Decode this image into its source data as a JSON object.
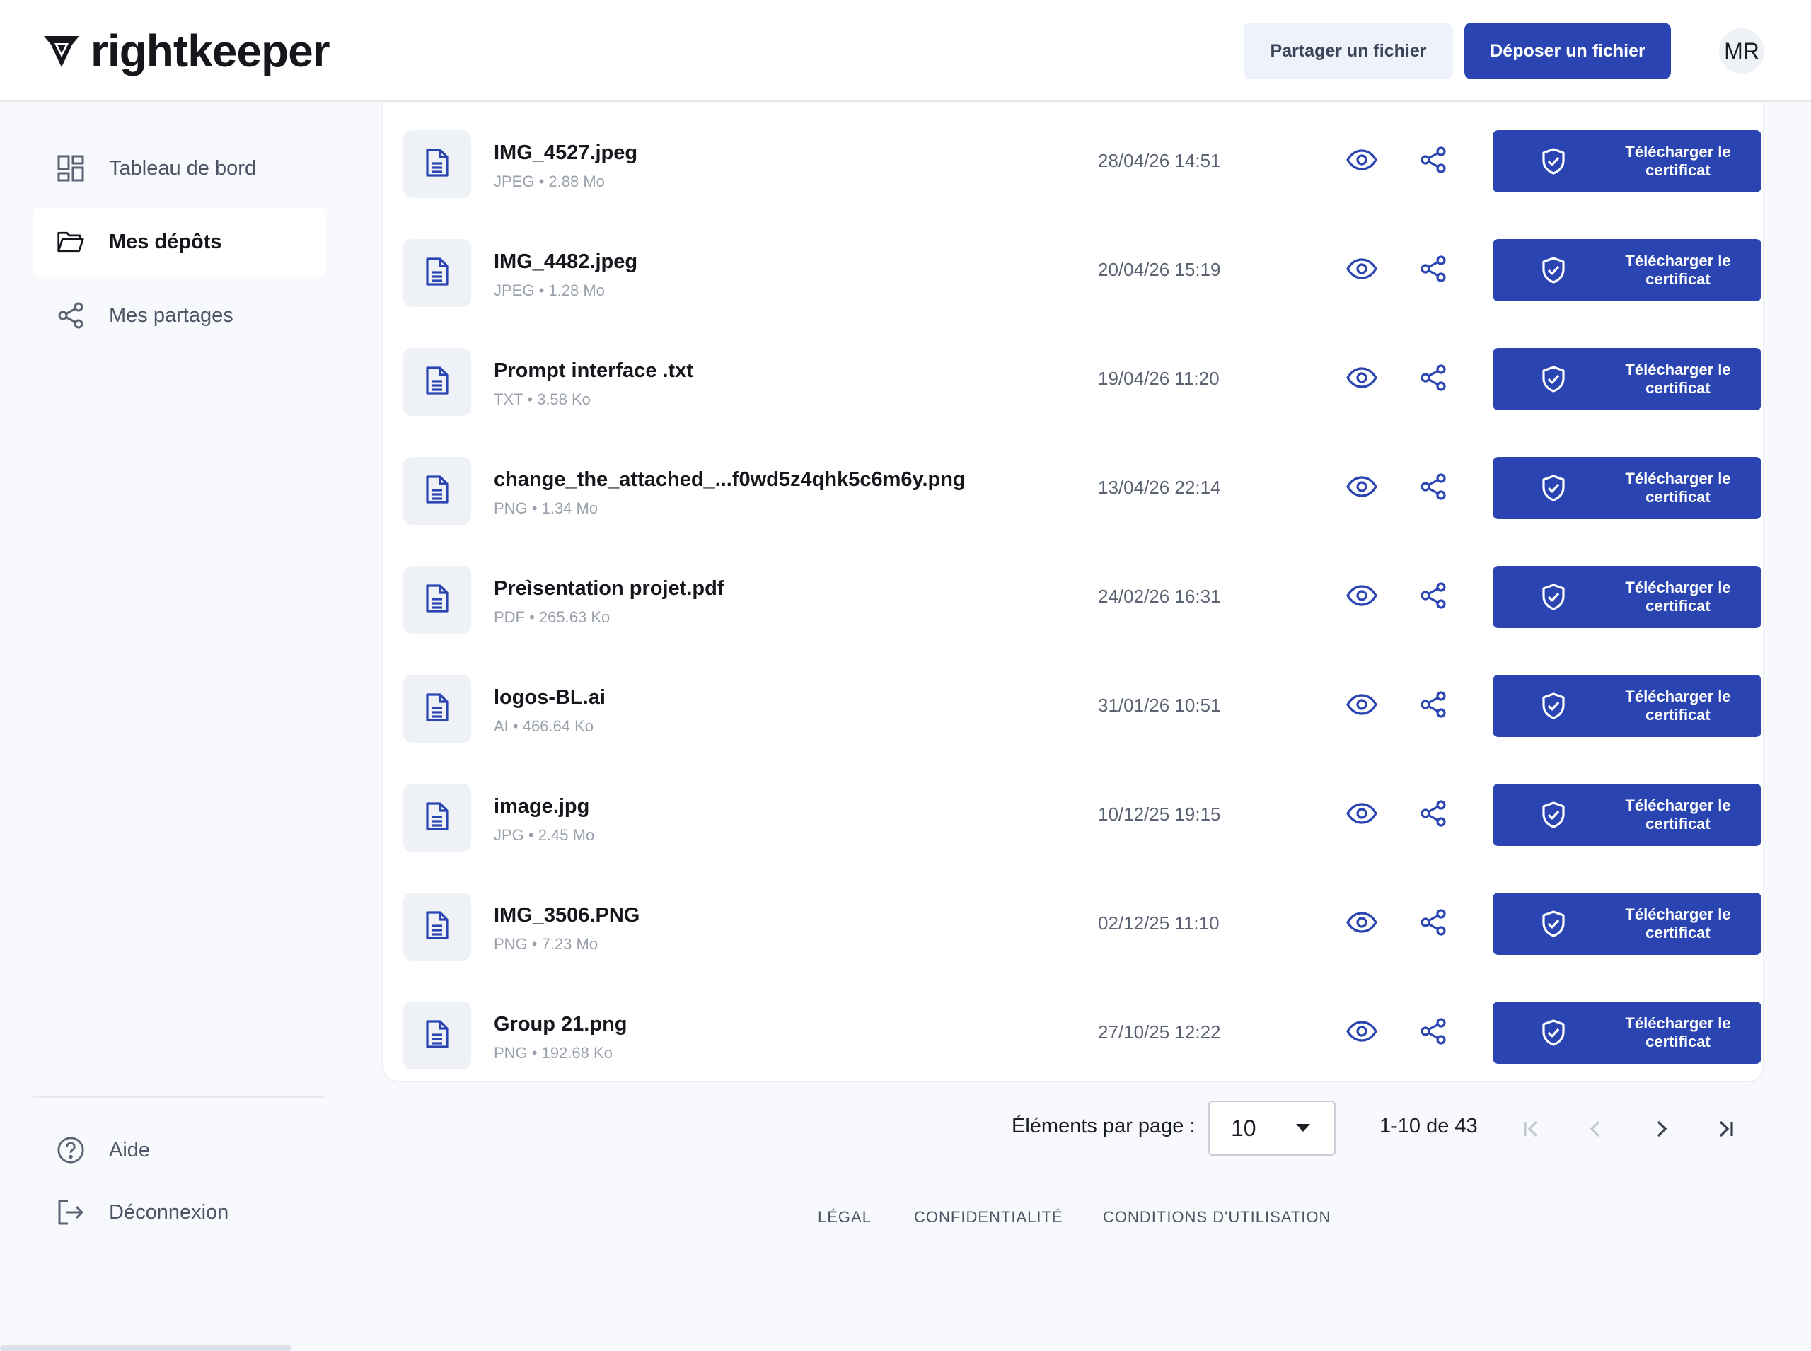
{
  "header": {
    "brand": "rightkeeper",
    "share_label": "Partager un fichier",
    "deposit_label": "Déposer un fichier",
    "avatar_initials": "MR"
  },
  "sidebar": {
    "items": [
      {
        "label": "Tableau de bord",
        "icon": "dashboard-icon",
        "active": false
      },
      {
        "label": "Mes dépôts",
        "icon": "folder-open-icon",
        "active": true
      },
      {
        "label": "Mes partages",
        "icon": "share-icon",
        "active": false
      }
    ],
    "bottom_items": [
      {
        "label": "Aide",
        "icon": "help-icon"
      },
      {
        "label": "Déconnexion",
        "icon": "logout-icon"
      }
    ]
  },
  "files": {
    "certificate_label": "Télécharger le certificat",
    "rows": [
      {
        "name": "IMG_4527.jpeg",
        "meta": "JPEG • 2.88 Mo",
        "date": "28/04/26 14:51"
      },
      {
        "name": "IMG_4482.jpeg",
        "meta": "JPEG • 1.28 Mo",
        "date": "20/04/26 15:19"
      },
      {
        "name": "Prompt interface .txt",
        "meta": "TXT • 3.58 Ko",
        "date": "19/04/26 11:20"
      },
      {
        "name": "change_the_attached_...f0wd5z4qhk5c6m6y.png",
        "meta": "PNG • 1.34 Mo",
        "date": "13/04/26 22:14"
      },
      {
        "name": "Preì\u0017sentation projet.pdf",
        "meta": "PDF • 265.63 Ko",
        "date": "24/02/26 16:31"
      },
      {
        "name": "logos-BL.ai",
        "meta": "AI • 466.64 Ko",
        "date": "31/01/26 10:51"
      },
      {
        "name": "image.jpg",
        "meta": "JPG • 2.45 Mo",
        "date": "10/12/25 19:15"
      },
      {
        "name": "IMG_3506.PNG",
        "meta": "PNG • 7.23 Mo",
        "date": "02/12/25 11:10"
      },
      {
        "name": "Group 21.png",
        "meta": "PNG • 192.68 Ko",
        "date": "27/10/25 12:22"
      }
    ]
  },
  "pagination": {
    "per_page_label": "Éléments par page :",
    "per_page_value": "10",
    "range_label": "1-10 de 43"
  },
  "footer": {
    "links": [
      "LÉGAL",
      "CONFIDENTIALITÉ",
      "CONDITIONS D'UTILISATION"
    ]
  },
  "colors": {
    "primary": "#2a45b2",
    "share_button_bg": "#eef3fb",
    "page_bg": "#f8f9fc"
  }
}
